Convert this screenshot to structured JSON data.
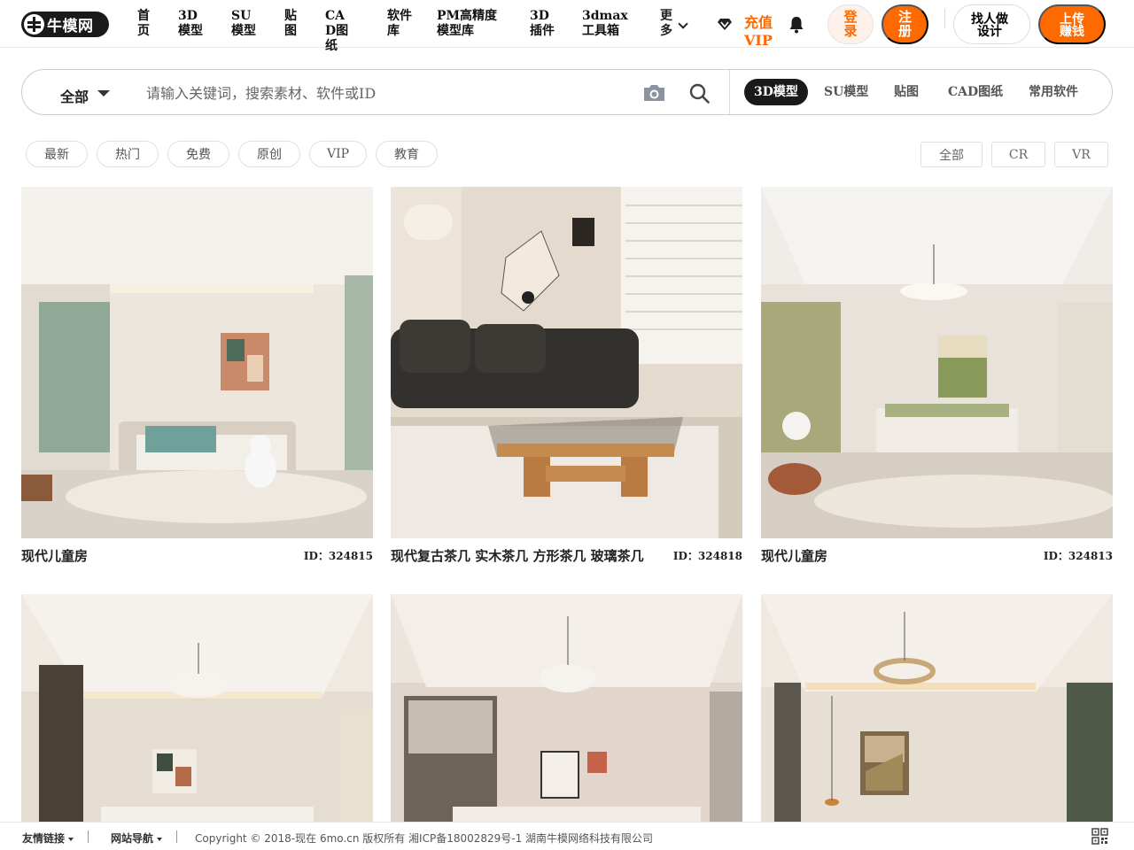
{
  "header": {
    "logo_text": "牛模网",
    "nav": [
      "首页",
      "3D模型",
      "SU模型",
      "贴图",
      "CAD图纸",
      "软件库",
      "PM高精度模型库",
      "3D插件",
      "3dmax工具箱"
    ],
    "more": "更多",
    "vip": "充值VIP",
    "login": "登录",
    "register": "注册",
    "find_designer": "找人做设计",
    "upload": "上传赚钱"
  },
  "search": {
    "scope": "全部",
    "placeholder": "请输入关键词，搜索素材、软件或ID",
    "tabs": [
      "3D模型",
      "SU模型",
      "贴图",
      "CAD图纸",
      "常用软件"
    ],
    "active_tab": "3D模型"
  },
  "filters": {
    "left": [
      "最新",
      "热门",
      "免费",
      "原创",
      "VIP",
      "教育"
    ],
    "right": [
      "全部",
      "CR",
      "VR"
    ]
  },
  "cards": [
    {
      "title": "现代儿童房",
      "id": "ID：324815"
    },
    {
      "title": "现代复古茶几 实木茶几 方形茶几 玻璃茶几",
      "id": "ID：324818"
    },
    {
      "title": "现代儿童房",
      "id": "ID：324813"
    },
    {
      "title": "",
      "id": ""
    },
    {
      "title": "",
      "id": ""
    },
    {
      "title": "",
      "id": ""
    }
  ],
  "footer": {
    "friend_links": "友情链接",
    "site_nav": "网站导航",
    "copyright": "Copyright © 2018-现在 6mo.cn 版权所有 湘ICP备18002829号-1 湖南牛模网络科技有限公司"
  },
  "colors": {
    "accent": "#ff6a00",
    "dark": "#1a1a1a"
  }
}
